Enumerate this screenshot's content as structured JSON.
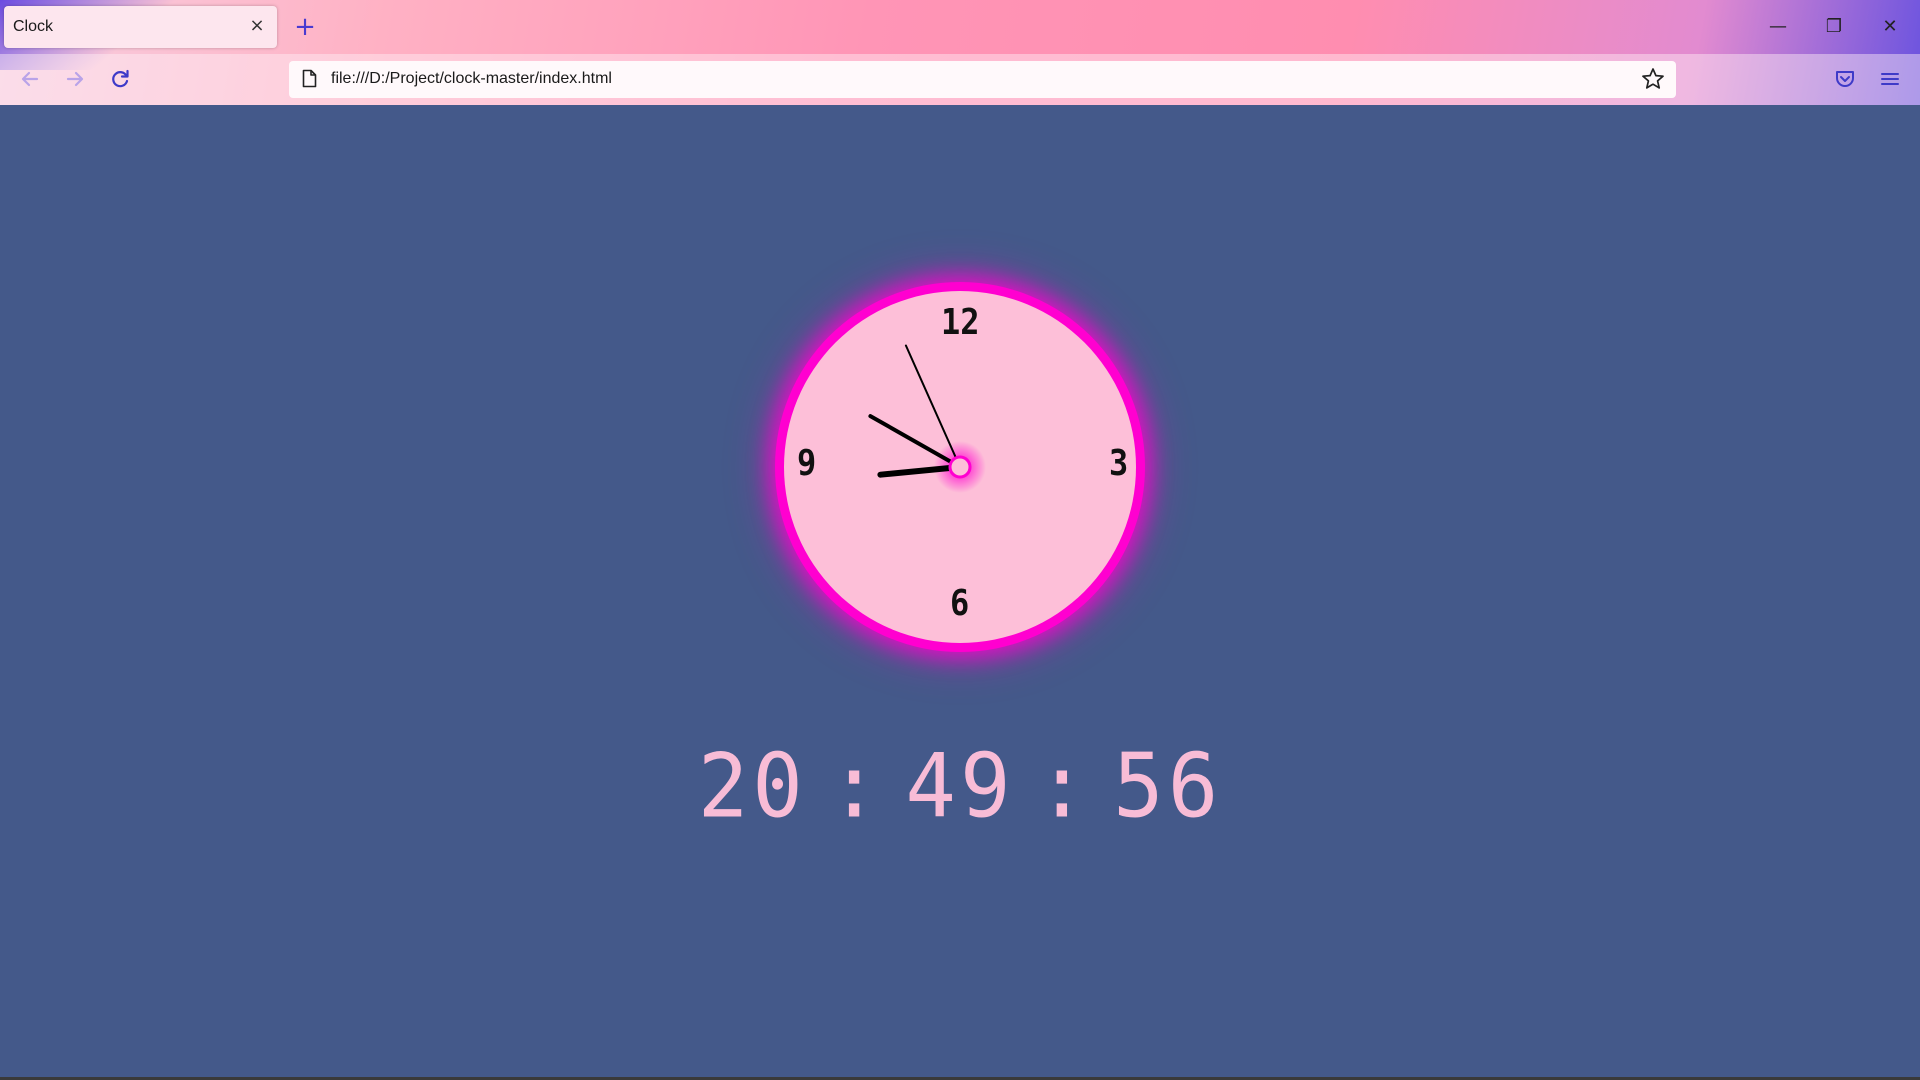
{
  "browser": {
    "tab": {
      "title": "Clock",
      "close_glyph": "×"
    },
    "new_tab_glyph": "+",
    "url": "file:///D:/Project/clock-master/index.html",
    "icons": {
      "back": "arrow-left-icon",
      "forward": "arrow-right-icon",
      "reload": "reload-icon",
      "page": "page-icon",
      "bookmark": "star-icon",
      "pocket": "pocket-icon",
      "menu": "hamburger-menu-icon"
    },
    "window_controls": {
      "minimize": "—",
      "restore": "❐",
      "close": "✕"
    }
  },
  "clock": {
    "numerals": {
      "twelve": "12",
      "three": "3",
      "six": "6",
      "nine": "9"
    },
    "time": {
      "hours": 20,
      "minutes": 49,
      "seconds": 56
    },
    "colors": {
      "ring": "#ff00d0",
      "face": "#fdbfd8",
      "background": "#44598a"
    }
  },
  "digital": {
    "hours": "20",
    "minutes": "49",
    "seconds": "56",
    "separator": ":"
  }
}
